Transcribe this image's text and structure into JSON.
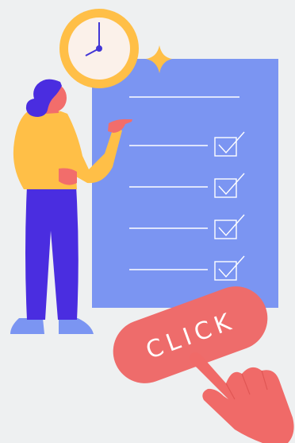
{
  "illustration": {
    "click_label": "CLICK",
    "checklist": {
      "rows": [
        {
          "checked": false
        },
        {
          "checked": true
        },
        {
          "checked": true
        },
        {
          "checked": true
        },
        {
          "checked": true
        }
      ]
    },
    "icons": [
      "clock-icon",
      "sparkle-icon",
      "checkbox-icon",
      "pointing-hand-icon"
    ],
    "colors": {
      "background": "#eef0f1",
      "board": "#7b95f2",
      "clock_ring": "#ffbf47",
      "clock_face": "#fbf1ea",
      "clock_hands": "#4236d6",
      "sparkle": "#ffbf47",
      "button": "#ee6c6b",
      "hand": "#f06a68",
      "shirt": "#ffbf47",
      "pants": "#4a2de0",
      "hair": "#4a2de0",
      "skin": "#f26d6b",
      "shoes": "#7b95f2"
    }
  }
}
